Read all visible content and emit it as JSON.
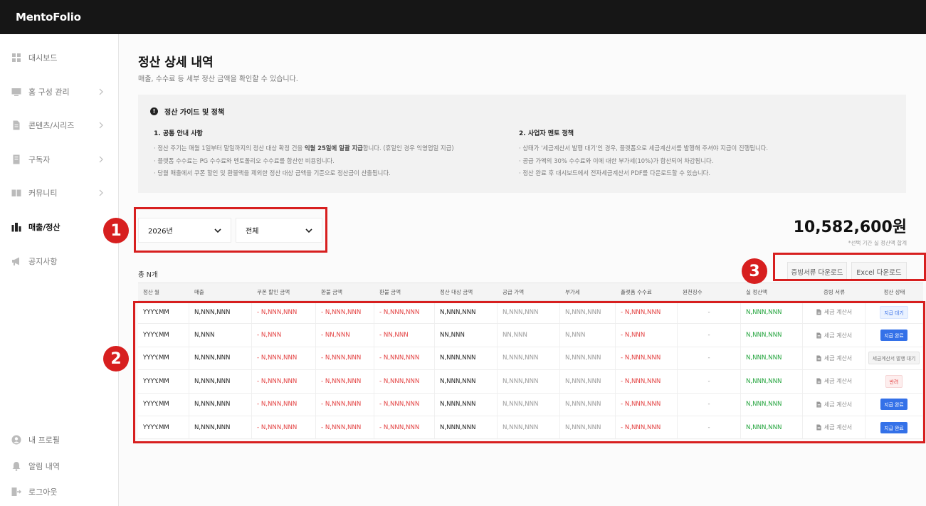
{
  "brand": "MentoFolio",
  "sidebar": {
    "items": [
      {
        "label": "대시보드",
        "icon": "dashboard-icon",
        "has_chevron": false
      },
      {
        "label": "홈 구성 관리",
        "icon": "monitor-icon",
        "has_chevron": true
      },
      {
        "label": "콘텐츠/시리즈",
        "icon": "document-icon",
        "has_chevron": true
      },
      {
        "label": "구독자",
        "icon": "subscriber-icon",
        "has_chevron": true
      },
      {
        "label": "커뮤니티",
        "icon": "book-icon",
        "has_chevron": true
      },
      {
        "label": "매출/정산",
        "icon": "bar-chart-icon",
        "has_chevron": false,
        "active": true
      },
      {
        "label": "공지사항",
        "icon": "megaphone-icon",
        "has_chevron": false
      }
    ],
    "bottom": [
      {
        "label": "내 프로필",
        "icon": "user-icon"
      },
      {
        "label": "알림 내역",
        "icon": "bell-icon"
      },
      {
        "label": "로그아웃",
        "icon": "logout-icon"
      }
    ]
  },
  "page": {
    "title": "정산 상세 내역",
    "subtitle": "매출, 수수료 등 세부 정산 금액을 확인할 수 있습니다."
  },
  "guide": {
    "title": "정산 가이드 및 정책",
    "col1": {
      "title": "1. 공통 안내 사항",
      "line1_pre": "· 정산 주기는 매월 1일부터 말일까지의 정산 대상 확정 건을 ",
      "line1_bold": "익월 25일에 일괄 지급",
      "line1_post": "합니다. (휴일인 경우 익영업일 지급)",
      "line2": "· 플랫폼 수수료는 PG 수수료와 멘토폴리오 수수료를 합산한 비용입니다.",
      "line3": "· 당월 매출에서 쿠폰 할인 및 환불액을 제외한 정산 대상 금액을 기준으로 정산금이 산출됩니다."
    },
    "col2": {
      "title": "2. 사업자 멘토 정책",
      "line1": "· 상태가 '세금계산서 발행 대기'인 경우, 플랫폼으로 세금계산서를 발행해 주셔야 지급이 진행됩니다.",
      "line2": "· 공급 가액의 30% 수수료와 이에 대한 부가세(10%)가 합산되어 차감됩니다.",
      "line3": "· 정산 완료 후 대시보드에서 전자세금계산서 PDF를 다운로드할 수 있습니다."
    }
  },
  "filters": {
    "year": "2026년",
    "type": "전체"
  },
  "summary": {
    "total": "10,582,600원",
    "caption": "*선택 기간 실 정산액 합계"
  },
  "list": {
    "count": "총 N개",
    "btn_docs": "증빙서류 다운로드",
    "btn_excel": "Excel 다운로드"
  },
  "markers": {
    "m1": "1",
    "m2": "2",
    "m3": "3"
  },
  "table": {
    "headers": [
      "정산 월",
      "매출",
      "쿠폰 할인 금액",
      "환불 금액",
      "환불 금액",
      "정산 대상 금액",
      "공급 가액",
      "부가세",
      "플랫폼 수수료",
      "원천징수",
      "실 정산액",
      "증빙 서류",
      "정산 상태"
    ],
    "rows": [
      {
        "month": "YYYY.MM",
        "sales": "N,NNN,NNN",
        "coupon": "- N,NNN,NNN",
        "refund1": "- N,NNN,NNN",
        "refund2": "- N,NNN,NNN",
        "target": "N,NNN,NNN",
        "supply": "N,NNN,NNN",
        "vat": "N,NNN,NNN",
        "fee": "- N,NNN,NNN",
        "withholding": "-",
        "net": "N,NNN,NNN",
        "doc": "세금 계산서",
        "status": "지급 대기",
        "status_type": "wait"
      },
      {
        "month": "YYYY.MM",
        "sales": "N,NNN",
        "coupon": "- N,NNN",
        "refund1": "- NN,NNN",
        "refund2": "- NN,NNN",
        "target": "NN,NNN",
        "supply": "NN,NNN",
        "vat": "N,NNN",
        "fee": "- N,NNN",
        "withholding": "-",
        "net": "N,NNN,NNN",
        "doc": "세금 계산서",
        "status": "지급 완료",
        "status_type": "done"
      },
      {
        "month": "YYYY.MM",
        "sales": "N,NNN,NNN",
        "coupon": "- N,NNN,NNN",
        "refund1": "- N,NNN,NNN",
        "refund2": "- N,NNN,NNN",
        "target": "N,NNN,NNN",
        "supply": "N,NNN,NNN",
        "vat": "N,NNN,NNN",
        "fee": "- N,NNN,NNN",
        "withholding": "-",
        "net": "N,NNN,NNN",
        "doc": "세금 계산서",
        "status": "세금계산서 발행 대기",
        "status_type": "issue"
      },
      {
        "month": "YYYY.MM",
        "sales": "N,NNN,NNN",
        "coupon": "- N,NNN,NNN",
        "refund1": "- N,NNN,NNN",
        "refund2": "- N,NNN,NNN",
        "target": "N,NNN,NNN",
        "supply": "N,NNN,NNN",
        "vat": "N,NNN,NNN",
        "fee": "- N,NNN,NNN",
        "withholding": "-",
        "net": "N,NNN,NNN",
        "doc": "세금 계산서",
        "status": "반려",
        "status_type": "return"
      },
      {
        "month": "YYYY.MM",
        "sales": "N,NNN,NNN",
        "coupon": "- N,NNN,NNN",
        "refund1": "- N,NNN,NNN",
        "refund2": "- N,NNN,NNN",
        "target": "N,NNN,NNN",
        "supply": "N,NNN,NNN",
        "vat": "N,NNN,NNN",
        "fee": "- N,NNN,NNN",
        "withholding": "-",
        "net": "N,NNN,NNN",
        "doc": "세금 계산서",
        "status": "지급 완료",
        "status_type": "done"
      },
      {
        "month": "YYYY.MM",
        "sales": "N,NNN,NNN",
        "coupon": "- N,NNN,NNN",
        "refund1": "- N,NNN,NNN",
        "refund2": "- N,NNN,NNN",
        "target": "N,NNN,NNN",
        "supply": "N,NNN,NNN",
        "vat": "N,NNN,NNN",
        "fee": "- N,NNN,NNN",
        "withholding": "-",
        "net": "N,NNN,NNN",
        "doc": "세금 계산서",
        "status": "지급 완료",
        "status_type": "done"
      }
    ]
  },
  "colors": {
    "accent": "#d71f1f",
    "negative": "#e34040",
    "positive": "#21a33b",
    "primary": "#3471e8"
  }
}
